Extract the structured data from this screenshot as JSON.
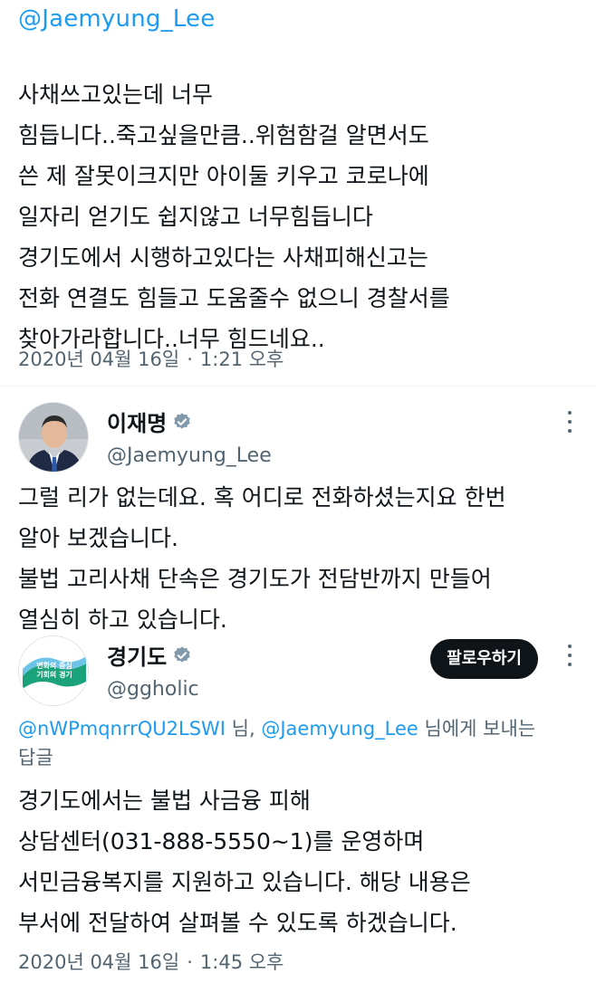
{
  "top_mention": "@Jaemyung_Lee",
  "original_tweet": {
    "lines": [
      "사채쓰고있는데 너무",
      "힘듭니다..죽고싶을만큼..위험함걸 알면서도",
      "쓴 제 잘못이크지만 아이둘 키우고 코로나에",
      "일자리 얻기도 쉽지않고 너무힘듭니다",
      "경기도에서 시행하고있다는 사채피해신고는",
      "전화 연결도 힘들고 도움줄수 없으니 경찰서를",
      "찾아가라합니다..너무 힘드네요.."
    ],
    "date": "2020년 04월 16일",
    "time": "1:21 오후"
  },
  "reply1": {
    "name": "이재명",
    "handle": "@Jaemyung_Lee",
    "avatar_icon": "portrait-avatar",
    "lines": [
      "그럴 리가 없는데요. 혹 어디로 전화하셨는지요 한번",
      "알아 보겠습니다.",
      "불법 고리사채 단속은 경기도가 전담반까지 만들어",
      "열심히 하고 있습니다."
    ]
  },
  "reply2": {
    "name": "경기도",
    "handle": "@ggholic",
    "follow_label": "팔로우하기",
    "logo_line1": "변화의 중심",
    "logo_line2": "기회의 경기",
    "reply_to_link1": "@nWPmqnrrQU2LSWI",
    "reply_to_mid": " 님, ",
    "reply_to_link2": "@Jaemyung_Lee",
    "reply_to_suffix": " 님에게 보내는",
    "reply_to_wrap": "답글",
    "lines": [
      "경기도에서는 불법 사금융 피해",
      "상담센터(031-888-5550~1)를 운영하며",
      "서민금융복지를 지원하고 있습니다. 해당 내용은",
      "부서에 전달하여 살펴볼 수 있도록 하겠습니다."
    ],
    "date": "2020년 04월 16일",
    "time": "1:45 오후"
  },
  "colors": {
    "accent": "#1d9bf0",
    "text": "#0f1419",
    "muted": "#536471",
    "verified": "#829aab"
  }
}
